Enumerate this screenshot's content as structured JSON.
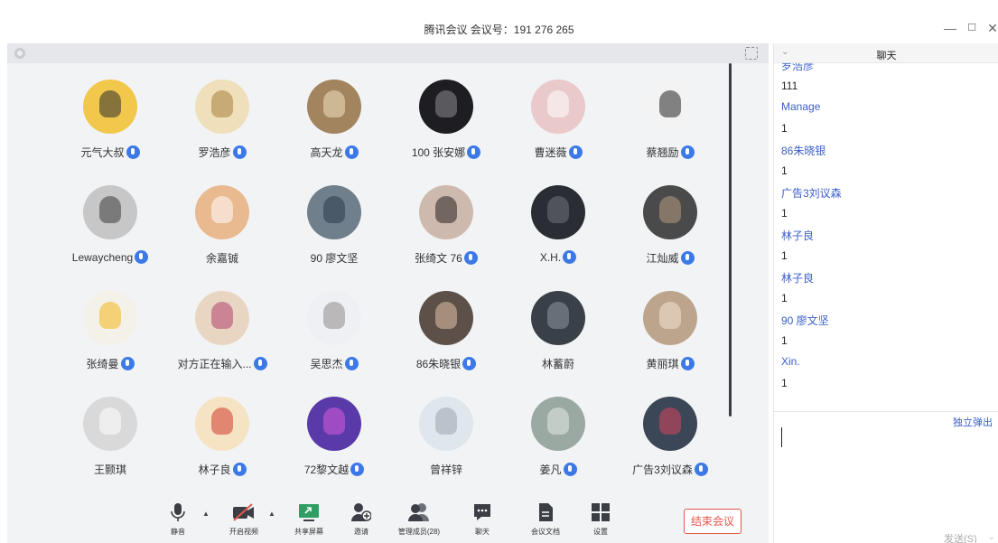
{
  "window": {
    "title": "腾讯会议 会议号：191 276 265",
    "minimize": "—",
    "maximize": "☐",
    "close": "✕"
  },
  "participants": [
    {
      "name": "元气大叔",
      "color": "#f1c84b",
      "mark": "#2d2d2d",
      "mic": true
    },
    {
      "name": "罗浩彦",
      "color": "#efe0bb",
      "mark": "#a87d3b",
      "mic": true
    },
    {
      "name": "高天龙",
      "color": "#a2845e",
      "mark": "#f3e2c3",
      "mic": true
    },
    {
      "name": "100 张安娜",
      "color": "#1d1d22",
      "mark": "#8a8a90",
      "mic": true
    },
    {
      "name": "曹迷薇",
      "color": "#e9c9c9",
      "mark": "#ffffff",
      "mic": true
    },
    {
      "name": "蔡翘励",
      "color": "#f3f3f3",
      "mark": "#222222",
      "mic": true
    },
    {
      "name": "Lewaycheng",
      "color": "#c7c7c7",
      "mark": "#3a3a3a",
      "mic": true
    },
    {
      "name": "余嘉铖",
      "color": "#e9b98f",
      "mark": "#ffffff",
      "mic": false
    },
    {
      "name": "90 廖文坚",
      "color": "#6f7f8b",
      "mark": "#2c3b4a",
      "mic": false
    },
    {
      "name": "张绮文 76",
      "color": "#cdb9ad",
      "mark": "#2a2220",
      "mic": true
    },
    {
      "name": "X.H.",
      "color": "#2a2d33",
      "mark": "#6f737b",
      "mic": true
    },
    {
      "name": "江灿威",
      "color": "#4a4a4a",
      "mark": "#b89a82",
      "mic": true
    },
    {
      "name": "张绮曼",
      "color": "#f4f1e8",
      "mark": "#f4b41a",
      "mic": true
    },
    {
      "name": "对方正在输入...",
      "color": "#e9d6c2",
      "mark": "#b0426e",
      "mic": true
    },
    {
      "name": "吴思杰",
      "color": "#eef0f3",
      "mark": "#8f8a86",
      "mic": true
    },
    {
      "name": "86朱晓银",
      "color": "#5d5048",
      "mark": "#e0c2a8",
      "mic": true
    },
    {
      "name": "林蓄蔚",
      "color": "#3a4048",
      "mark": "#8d96a0",
      "mic": false
    },
    {
      "name": "黄丽琪",
      "color": "#bda58d",
      "mark": "#f2e6d6",
      "mic": true
    },
    {
      "name": "王颢琪",
      "color": "#d9d9d9",
      "mark": "#ffffff",
      "mic": false
    },
    {
      "name": "林子良",
      "color": "#f6e3c3",
      "mark": "#d03a2c",
      "mic": true
    },
    {
      "name": "72黎文越",
      "color": "#5a3aa8",
      "mark": "#d95ad8",
      "mic": true
    },
    {
      "name": "曾祥锌",
      "color": "#dfe6ec",
      "mark": "#9aa6b0",
      "mic": false
    },
    {
      "name": "姜凡",
      "color": "#9aa9a1",
      "mark": "#e8eaea",
      "mic": true
    },
    {
      "name": "广告3刘议森",
      "color": "#3b4657",
      "mark": "#d7465e",
      "mic": true
    }
  ],
  "toolbar": {
    "mute": "静音",
    "video": "开启视频",
    "share": "共享屏幕",
    "invite": "邀请",
    "members": "管理成员(28)",
    "chat": "聊天",
    "docs": "会议文档",
    "settings": "设置",
    "end": "结束会议"
  },
  "chat": {
    "title": "聊天",
    "messages": [
      {
        "sender": "罗浩彦",
        "text": "111"
      },
      {
        "sender": "Manage",
        "text": "1"
      },
      {
        "sender": "86朱晓银",
        "text": "1"
      },
      {
        "sender": "广告3刘议森",
        "text": "1"
      },
      {
        "sender": "林子良",
        "text": "1"
      },
      {
        "sender": "林子良",
        "text": "1"
      },
      {
        "sender": "90 廖文坚",
        "text": "1"
      },
      {
        "sender": "Xin.",
        "text": "1"
      }
    ],
    "popout": "独立弹出",
    "send": "发送(S)"
  }
}
